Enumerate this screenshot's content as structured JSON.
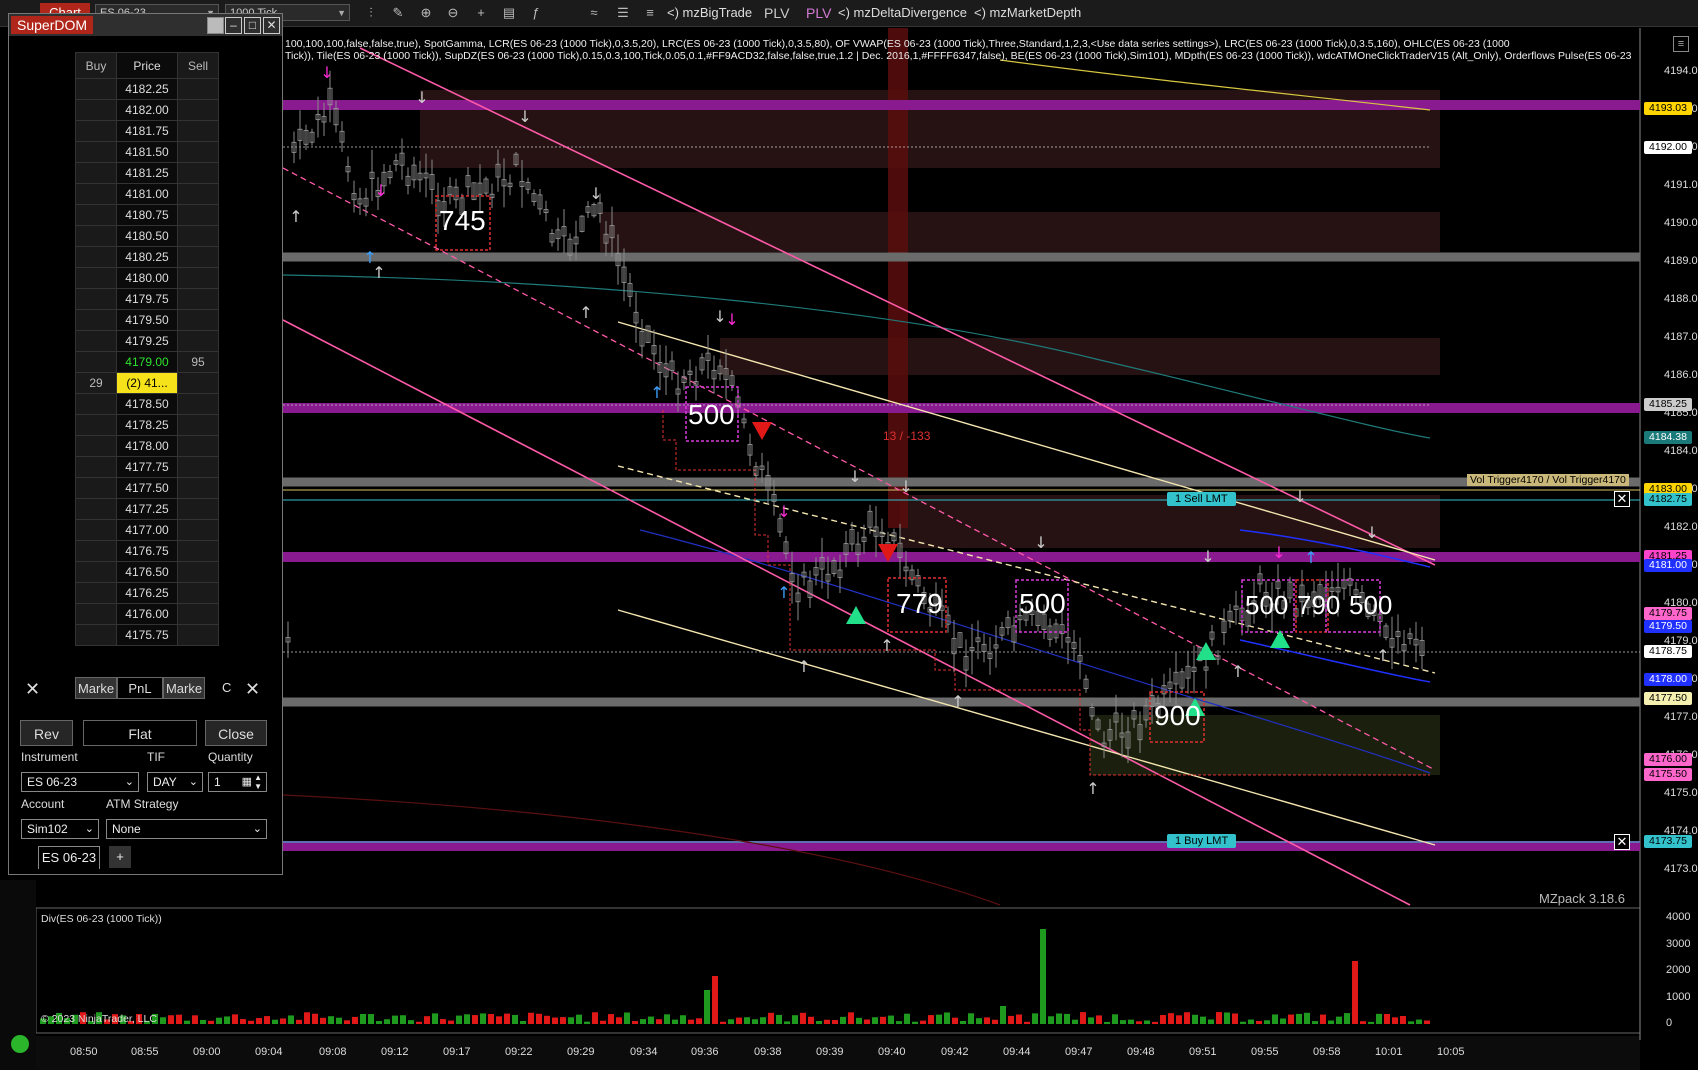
{
  "toolbar": {
    "chart_tab": "Chart",
    "instrument_combo": "ES 06-23",
    "interval_combo": "1000 Tick",
    "items": [
      "<) mzBigTrade",
      "PLV",
      "PLV",
      "<) mzDeltaDivergence",
      "<) mzMarketDepth"
    ]
  },
  "indicator_text": {
    "line1": "100,100,100,false,false,true), SpotGamma, LCR(ES 06-23 (1000 Tick),0,3.5,20), LRC(ES 06-23 (1000 Tick),0,3.5,80), OF VWAP(ES 06-23 (1000 Tick),Three,Standard,1,2,3,<Use data series settings>), LRC(ES 06-23 (1000 Tick),0,3.5,160), OHLC(ES 06-23 (1000",
    "line2": "Tick)), Tile(ES 06-23 (1000 Tick)), SupDZ(ES 06-23 (1000 Tick),0.15,0.3,100,Tick,0.05,0.1,#FF9ACD32,false,false,true,1.2 | Dec. 2016,1,#FFFF6347,false), BE(ES 06-23 (1000 Tick),Sim101), MDpth(ES 06-23 (1000 Tick)), wdcATMOneClickTraderV15 (Alt_Only), Orderflows Pulse(ES 06-23"
  },
  "price_axis": {
    "labels": [
      "4194.00",
      "4193.00",
      "4192.00",
      "4191.00",
      "4190.00",
      "4189.00",
      "4188.00",
      "4187.00",
      "4186.00",
      "4185.00",
      "4184.00",
      "4183.00",
      "4182.00",
      "4181.00",
      "4180.00",
      "4179.00",
      "4178.00",
      "4177.00",
      "4176.00",
      "4175.00",
      "4174.00",
      "4173.00"
    ],
    "tags": [
      {
        "text": "4193.03",
        "bg": "#ffd400",
        "fg": "#000",
        "price": 4193.03
      },
      {
        "text": "4192.00",
        "bg": "#ffffff",
        "fg": "#000",
        "price": 4192.0
      },
      {
        "text": "4185.25",
        "bg": "#cccccc",
        "fg": "#000",
        "price": 4185.25
      },
      {
        "text": "4184.38",
        "bg": "#1a7a7a",
        "fg": "#fff",
        "price": 4184.38
      },
      {
        "text": "4183.00",
        "bg": "#ffd400",
        "fg": "#000",
        "price": 4183.0
      },
      {
        "text": "4182.75",
        "bg": "#33c2cc",
        "fg": "#000",
        "price": 4182.75
      },
      {
        "text": "4181.25",
        "bg": "#ff44cc",
        "fg": "#000",
        "price": 4181.25
      },
      {
        "text": "4181.00",
        "bg": "#2030ff",
        "fg": "#fff",
        "price": 4181.0
      },
      {
        "text": "4179.75",
        "bg": "#ff66cc",
        "fg": "#000",
        "price": 4179.75
      },
      {
        "text": "4179.50",
        "bg": "#2030ff",
        "fg": "#fff",
        "price": 4179.4
      },
      {
        "text": "4178.75",
        "bg": "#ffffff",
        "fg": "#000",
        "price": 4178.75
      },
      {
        "text": "4178.00",
        "bg": "#2030ff",
        "fg": "#fff",
        "price": 4178.0
      },
      {
        "text": "4177.50",
        "bg": "#f5f0b0",
        "fg": "#000",
        "price": 4177.5
      },
      {
        "text": "4176.00",
        "bg": "#ff66cc",
        "fg": "#000",
        "price": 4175.9
      },
      {
        "text": "4175.50",
        "bg": "#ff66cc",
        "fg": "#000",
        "price": 4175.5
      },
      {
        "text": "4173.75",
        "bg": "#33c2cc",
        "fg": "#000",
        "price": 4173.75
      }
    ]
  },
  "vol_trigger": "Vol Trigger4170 / Vol Trigger4170",
  "orders": {
    "sell": "1  Sell LMT",
    "buy": "1  Buy LMT"
  },
  "chart_annotations": {
    "numbers": [
      "745",
      "500",
      "779",
      "500",
      "900",
      "500",
      "790",
      "500"
    ],
    "stat": "13 / -133",
    "watermark": "MZpack 3.18.6"
  },
  "lower_panel": {
    "title": "Div(ES 06-23 (1000 Tick))",
    "copyright": "© 2023 NinjaTrader, LLC",
    "axis": [
      "4000",
      "3000",
      "2000",
      "1000",
      "0"
    ]
  },
  "time_axis": [
    "08:50",
    "08:55",
    "09:00",
    "09:04",
    "09:08",
    "09:12",
    "09:17",
    "09:22",
    "09:29",
    "09:34",
    "09:36",
    "09:38",
    "09:39",
    "09:40",
    "09:42",
    "09:44",
    "09:47",
    "09:48",
    "09:51",
    "09:55",
    "09:58",
    "10:01",
    "10:05"
  ],
  "colors": {
    "purple_band": "#8a1a8f",
    "gray_band": "#6b6b6b",
    "supply_zone": "#3a1a1a",
    "demand_zone": "#1e2410",
    "channel": "#ff5aa8",
    "regression": "#f5e6b0"
  },
  "superdom": {
    "title": "SuperDOM",
    "headers": {
      "buy": "Buy",
      "price": "Price",
      "sell": "Sell"
    },
    "rows": [
      {
        "buy": "",
        "price": "4182.25",
        "sell": ""
      },
      {
        "buy": "",
        "price": "4182.00",
        "sell": ""
      },
      {
        "buy": "",
        "price": "4181.75",
        "sell": ""
      },
      {
        "buy": "",
        "price": "4181.50",
        "sell": ""
      },
      {
        "buy": "",
        "price": "4181.25",
        "sell": ""
      },
      {
        "buy": "",
        "price": "4181.00",
        "sell": ""
      },
      {
        "buy": "",
        "price": "4180.75",
        "sell": ""
      },
      {
        "buy": "",
        "price": "4180.50",
        "sell": ""
      },
      {
        "buy": "",
        "price": "4180.25",
        "sell": ""
      },
      {
        "buy": "",
        "price": "4180.00",
        "sell": ""
      },
      {
        "buy": "",
        "price": "4179.75",
        "sell": ""
      },
      {
        "buy": "",
        "price": "4179.50",
        "sell": ""
      },
      {
        "buy": "",
        "price": "4179.25",
        "sell": ""
      },
      {
        "buy": "",
        "price": "4179.00",
        "sell": "95",
        "style": "last"
      },
      {
        "buy": "29",
        "price": "(2) 41...",
        "sell": "",
        "style": "position"
      },
      {
        "buy": "",
        "price": "4178.50",
        "sell": ""
      },
      {
        "buy": "",
        "price": "4178.25",
        "sell": ""
      },
      {
        "buy": "",
        "price": "4178.00",
        "sell": ""
      },
      {
        "buy": "",
        "price": "4177.75",
        "sell": ""
      },
      {
        "buy": "",
        "price": "4177.50",
        "sell": ""
      },
      {
        "buy": "",
        "price": "4177.25",
        "sell": ""
      },
      {
        "buy": "",
        "price": "4177.00",
        "sell": ""
      },
      {
        "buy": "",
        "price": "4176.75",
        "sell": ""
      },
      {
        "buy": "",
        "price": "4176.50",
        "sell": ""
      },
      {
        "buy": "",
        "price": "4176.25",
        "sell": ""
      },
      {
        "buy": "",
        "price": "4176.00",
        "sell": ""
      },
      {
        "buy": "",
        "price": "4175.75",
        "sell": ""
      }
    ],
    "footer": {
      "market_left": "Marke",
      "pnl": "PnL",
      "market_right": "Marke",
      "c": "C"
    },
    "buttons": {
      "rev": "Rev",
      "flat": "Flat",
      "close": "Close"
    },
    "labels": {
      "instrument": "Instrument",
      "tif": "TIF",
      "quantity": "Quantity",
      "account": "Account",
      "atm": "ATM Strategy"
    },
    "values": {
      "instrument": "ES 06-23",
      "tif": "DAY",
      "quantity": "1",
      "account": "Sim102",
      "atm": "None"
    },
    "tab": "ES 06-23",
    "add_tab": "+"
  }
}
